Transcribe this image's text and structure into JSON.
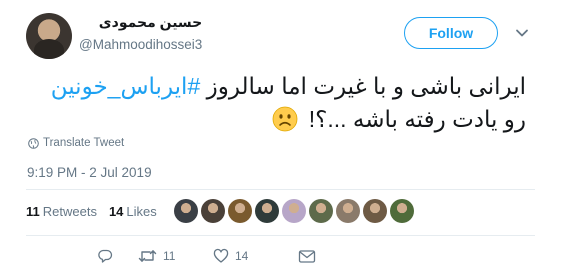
{
  "user": {
    "display_name": "حسین محمودی",
    "handle": "@Mahmoodihossei3"
  },
  "follow_button": {
    "label": "Follow"
  },
  "tweet": {
    "text_part1": "ایرانی باشی و با غیرت اما سالروز ",
    "hashtag": "#ایرباس_خونین",
    "text_part2": " رو یادت رفته باشه ...؟!",
    "emoji": "sad-face-emoji"
  },
  "translate_label": "Translate Tweet",
  "timestamp": "9:19 PM - 2 Jul 2019",
  "stats": {
    "retweets_count": "11",
    "retweets_label": "Retweets",
    "likes_count": "14",
    "likes_label": "Likes"
  },
  "likers": [
    {
      "color": "#3a3f45"
    },
    {
      "color": "#4a4038"
    },
    {
      "color": "#7a5a2e"
    },
    {
      "color": "#2f3b3a"
    },
    {
      "color": "#b7a6c8"
    },
    {
      "color": "#5d6a4a"
    },
    {
      "color": "#8a7a6a"
    },
    {
      "color": "#6e5a44"
    },
    {
      "color": "#4f6b3a"
    }
  ],
  "actions": {
    "reply_icon": "reply-icon",
    "retweet_icon": "retweet-icon",
    "retweet_count": "11",
    "like_icon": "heart-icon",
    "like_count": "14",
    "dm_icon": "envelope-icon"
  },
  "colors": {
    "accent": "#1da1f2",
    "muted": "#657786",
    "text": "#14171a"
  }
}
